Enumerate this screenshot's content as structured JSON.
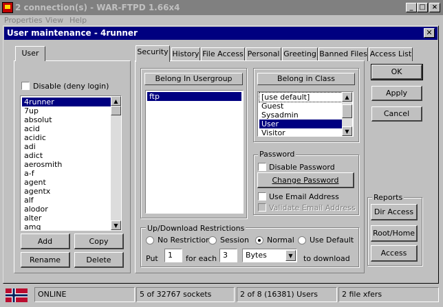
{
  "window": {
    "title": "2 connection(s) - WAR-FTPD 1.66x4"
  },
  "menu": [
    "Properties",
    "View",
    "Help"
  ],
  "dialog": {
    "title": "User maintenance - 4runner",
    "user_tab": "User",
    "disable_label": "Disable (deny login)",
    "users": [
      "4runner",
      "7up",
      "absolut",
      "acid",
      "acidic",
      "adi",
      "adict",
      "aerosmith",
      "a-f",
      "agent",
      "agentx",
      "alf",
      "alodor",
      "alter",
      "amq"
    ],
    "buttons": {
      "add": "Add",
      "copy": "Copy",
      "rename": "Rename",
      "delete": "Delete",
      "ok": "OK",
      "apply": "Apply",
      "cancel": "Cancel"
    },
    "tabs": [
      "Security",
      "History",
      "File Access",
      "Personal",
      "Greeting",
      "Banned Files",
      "Access List"
    ],
    "usergroup_header": "Belong In Usergroup",
    "usergroups": [
      "ftp"
    ],
    "class_header": "Belong in Class",
    "classes": [
      "[use default]",
      "Guest",
      "Sysadmin",
      "User",
      "Visitor"
    ],
    "password": {
      "legend": "Password",
      "disable": "Disable Password",
      "change": "Change Password",
      "use_email": "Use Email Address",
      "validate_email": "Validate Email Address"
    },
    "reports": {
      "legend": "Reports",
      "dir_access": "Dir Access",
      "root_home": "Root/Home",
      "access": "Access"
    },
    "restrictions": {
      "legend": "Up/Download Restrictions",
      "options": [
        "No Restriction",
        "Session",
        "Normal",
        "Use Default"
      ],
      "selected": "Normal",
      "put_label": "Put",
      "put_value": "1",
      "for_each": "for each",
      "each_value": "3",
      "unit": "Bytes",
      "to_download": "to download"
    }
  },
  "status": {
    "state": "ONLINE",
    "sockets": "5 of 32767 sockets",
    "users": "2 of 8 (16381) Users",
    "xfers": "2 file xfers"
  }
}
